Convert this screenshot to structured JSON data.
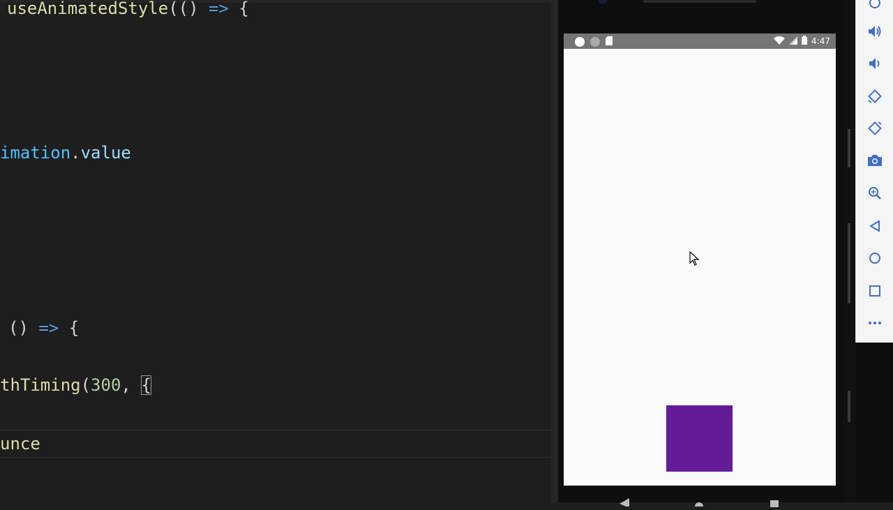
{
  "editor": {
    "lines": [
      {
        "parts": [
          {
            "text": "useAnimatedStyle",
            "cls": "tok-fn"
          },
          {
            "text": "(() ",
            "cls": "tok-punc"
          },
          {
            "text": "=>",
            "cls": "tok-kw"
          },
          {
            "text": " {",
            "cls": "tok-punc"
          }
        ]
      },
      {
        "parts": [
          {
            "text": "imation",
            "cls": "tok-var"
          },
          {
            "text": ".",
            "cls": "tok-punc"
          },
          {
            "text": "value",
            "cls": "tok-prop"
          }
        ]
      },
      {
        "parts": [
          {
            "text": "() ",
            "cls": "tok-punc"
          },
          {
            "text": "=>",
            "cls": "tok-kw"
          },
          {
            "text": " {",
            "cls": "tok-punc"
          }
        ]
      },
      {
        "parts": [
          {
            "text": "thTiming",
            "cls": "tok-fn"
          },
          {
            "text": "(",
            "cls": "tok-punc"
          },
          {
            "text": "300",
            "cls": "tok-num"
          },
          {
            "text": ", ",
            "cls": "tok-punc"
          },
          {
            "text": "{",
            "cls": "tok-punc bracket-match"
          }
        ]
      },
      {
        "parts": [
          {
            "text": "unce",
            "cls": "tok-fn"
          }
        ]
      }
    ]
  },
  "status_bar": {
    "time": "4:47"
  },
  "app": {
    "box_color": "#631b98"
  },
  "toolbar": {
    "buttons": [
      "power-icon",
      "volume-up-icon",
      "volume-down-icon",
      "rotate-left-icon",
      "rotate-right-icon",
      "camera-icon",
      "zoom-icon",
      "back-icon",
      "home-icon",
      "overview-icon",
      "more-icon"
    ]
  }
}
